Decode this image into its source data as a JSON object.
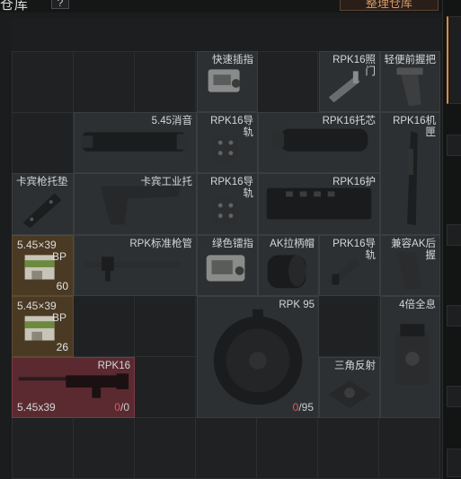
{
  "header": {
    "title": "仓库",
    "help": "?",
    "sort_button": "整理仓库"
  },
  "items": [
    {
      "id": "quick-switch",
      "label": "快速插指"
    },
    {
      "id": "rpk16-sight",
      "label": "RPK16照门"
    },
    {
      "id": "light-grip",
      "label": "轻便前握把"
    },
    {
      "id": "suppressor",
      "label": "5.45消音"
    },
    {
      "id": "rpk16-rail1",
      "label": "RPK16导轨"
    },
    {
      "id": "rpk16-stock-core",
      "label": "RPK16托芯"
    },
    {
      "id": "rpk16-receiver",
      "label": "RPK16机匣"
    },
    {
      "id": "carbine-pad",
      "label": "卡宾枪托垫"
    },
    {
      "id": "carbine-stock",
      "label": "卡宾工业托"
    },
    {
      "id": "rpk16-rail2",
      "label": "RPK16导轨"
    },
    {
      "id": "rpk16-handguard",
      "label": "RPK16护"
    },
    {
      "id": "ammo1",
      "label_top": "5.45×39",
      "label_bp": "BP",
      "count": "60"
    },
    {
      "id": "rpk-barrel",
      "label": "RPK标准枪管"
    },
    {
      "id": "green-laser",
      "label": "绿色镭指"
    },
    {
      "id": "ak-cap",
      "label": "AK拉柄帽"
    },
    {
      "id": "prk16-rail",
      "label": "PRK16导轨"
    },
    {
      "id": "ak-grip",
      "label": "兼容AK后握"
    },
    {
      "id": "ammo2",
      "label_top": "5.45×39",
      "label_bp": "BP",
      "count": "26"
    },
    {
      "id": "rpk95",
      "label": "RPK 95",
      "ammo_cur": "0",
      "ammo_max": "/95"
    },
    {
      "id": "scope4x",
      "label": "4倍全息"
    },
    {
      "id": "rpk16-gun",
      "label": "RPK16",
      "caliber": "5.45x39",
      "ammo_cur": "0",
      "ammo_max": "/0"
    },
    {
      "id": "reflex",
      "label": "三角反射"
    }
  ]
}
